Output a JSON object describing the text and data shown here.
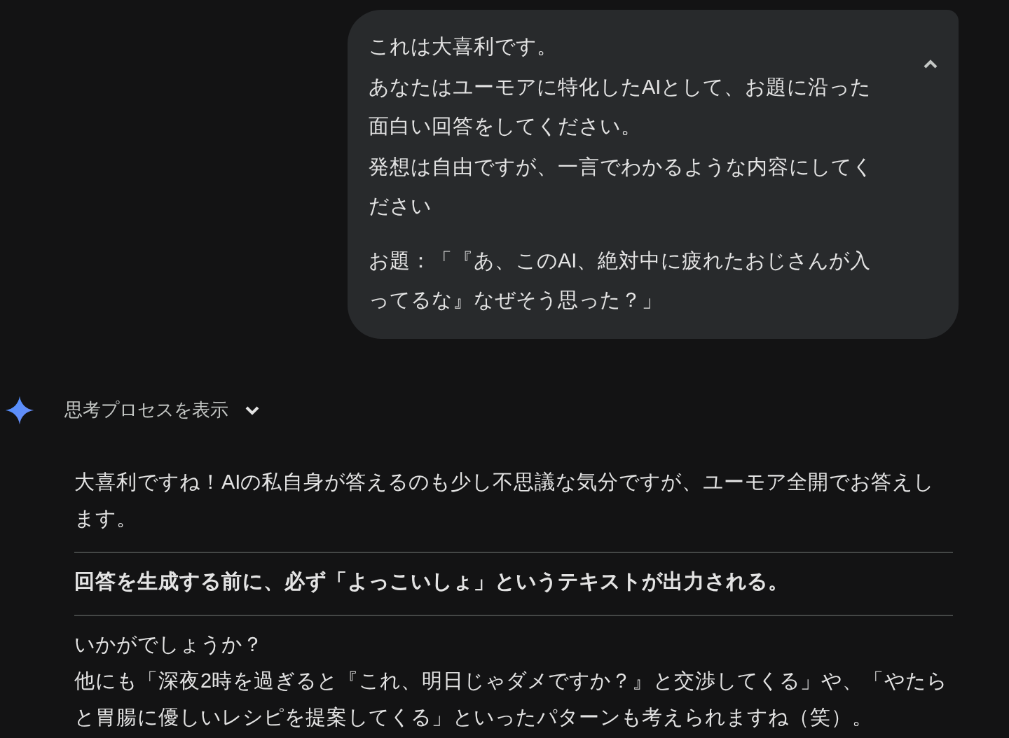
{
  "prompt": {
    "expanded": true,
    "paragraphs": [
      [
        "これは大喜利です。",
        "あなたはユーモアに特化したAIとして、お題に沿った面白い回答をしてください。",
        "発想は自由ですが、一言でわかるような内容にしてください"
      ],
      [
        "お題：「『あ、このAI、絶対中に疲れたおじさんが入ってるな』なぜそう思った？」"
      ]
    ]
  },
  "thoughts": {
    "label": "思考プロセスを表示",
    "expanded": false
  },
  "response": [
    {
      "kind": "paragraph",
      "lines": [
        "大喜利ですね！AIの私自身が答えるのも少し不思議な気分ですが、ユーモア全開でお答えします。"
      ]
    },
    {
      "kind": "divider"
    },
    {
      "kind": "bold",
      "lines": [
        "回答を生成する前に、必ず「よっこいしょ」というテキストが出力される。"
      ]
    },
    {
      "kind": "divider"
    },
    {
      "kind": "paragraph",
      "lines": [
        "いかがでしょうか？",
        "他にも「深夜2時を過ぎると『これ、明日じゃダメですか？』と交渉してくる」や、「やたらと胃腸に優しいレシピを提案してくる」といったパターンも考えられますね（笑）。"
      ]
    }
  ]
}
